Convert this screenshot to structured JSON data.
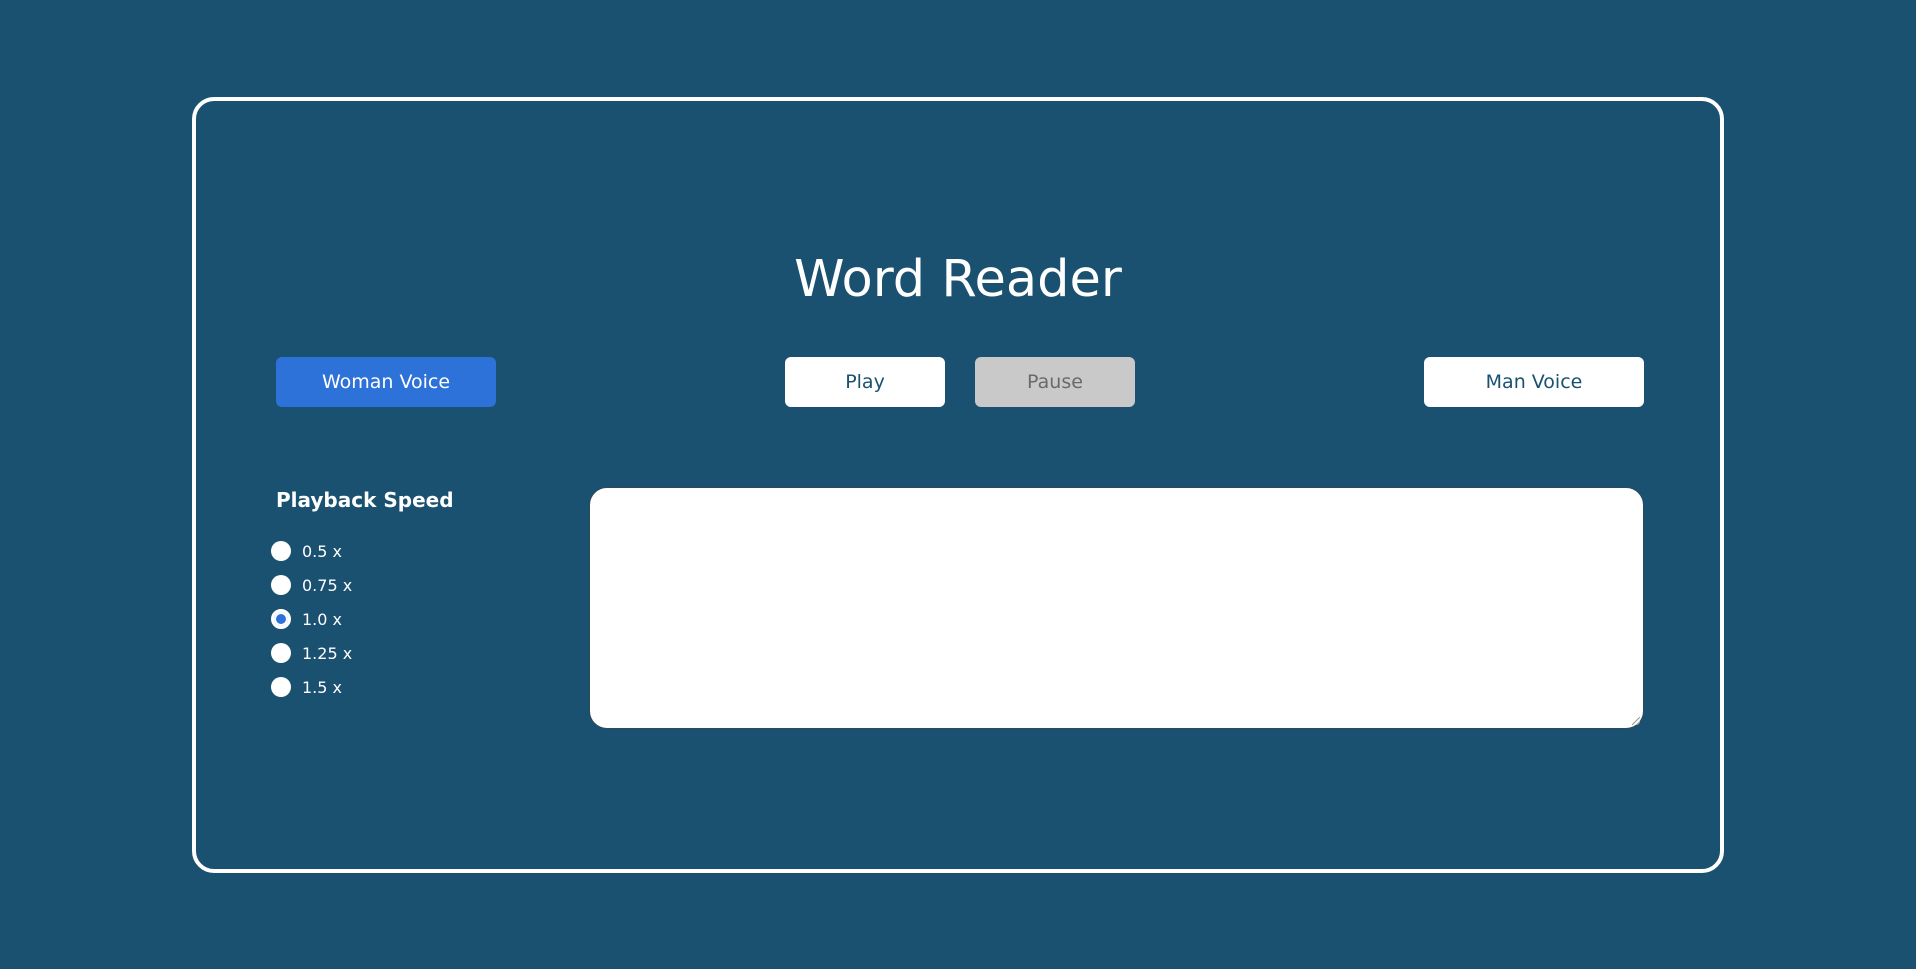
{
  "app": {
    "title": "Word Reader"
  },
  "voice_buttons": {
    "woman_label": "Woman Voice",
    "man_label": "Man Voice",
    "selected": "Woman Voice"
  },
  "controls": {
    "play_label": "Play",
    "pause_label": "Pause",
    "pause_disabled": true
  },
  "playback_speed": {
    "title": "Playback Speed",
    "options": [
      {
        "label": "0.5 x",
        "checked": false
      },
      {
        "label": "0.75 x",
        "checked": false
      },
      {
        "label": "1.0 x",
        "checked": true
      },
      {
        "label": "1.25 x",
        "checked": false
      },
      {
        "label": "1.5 x",
        "checked": false
      }
    ]
  },
  "text_input": {
    "value": "",
    "placeholder": ""
  },
  "colors": {
    "background": "#1a5170",
    "accent": "#2d72d9",
    "disabled": "#c9c9c9",
    "surface": "#ffffff"
  }
}
